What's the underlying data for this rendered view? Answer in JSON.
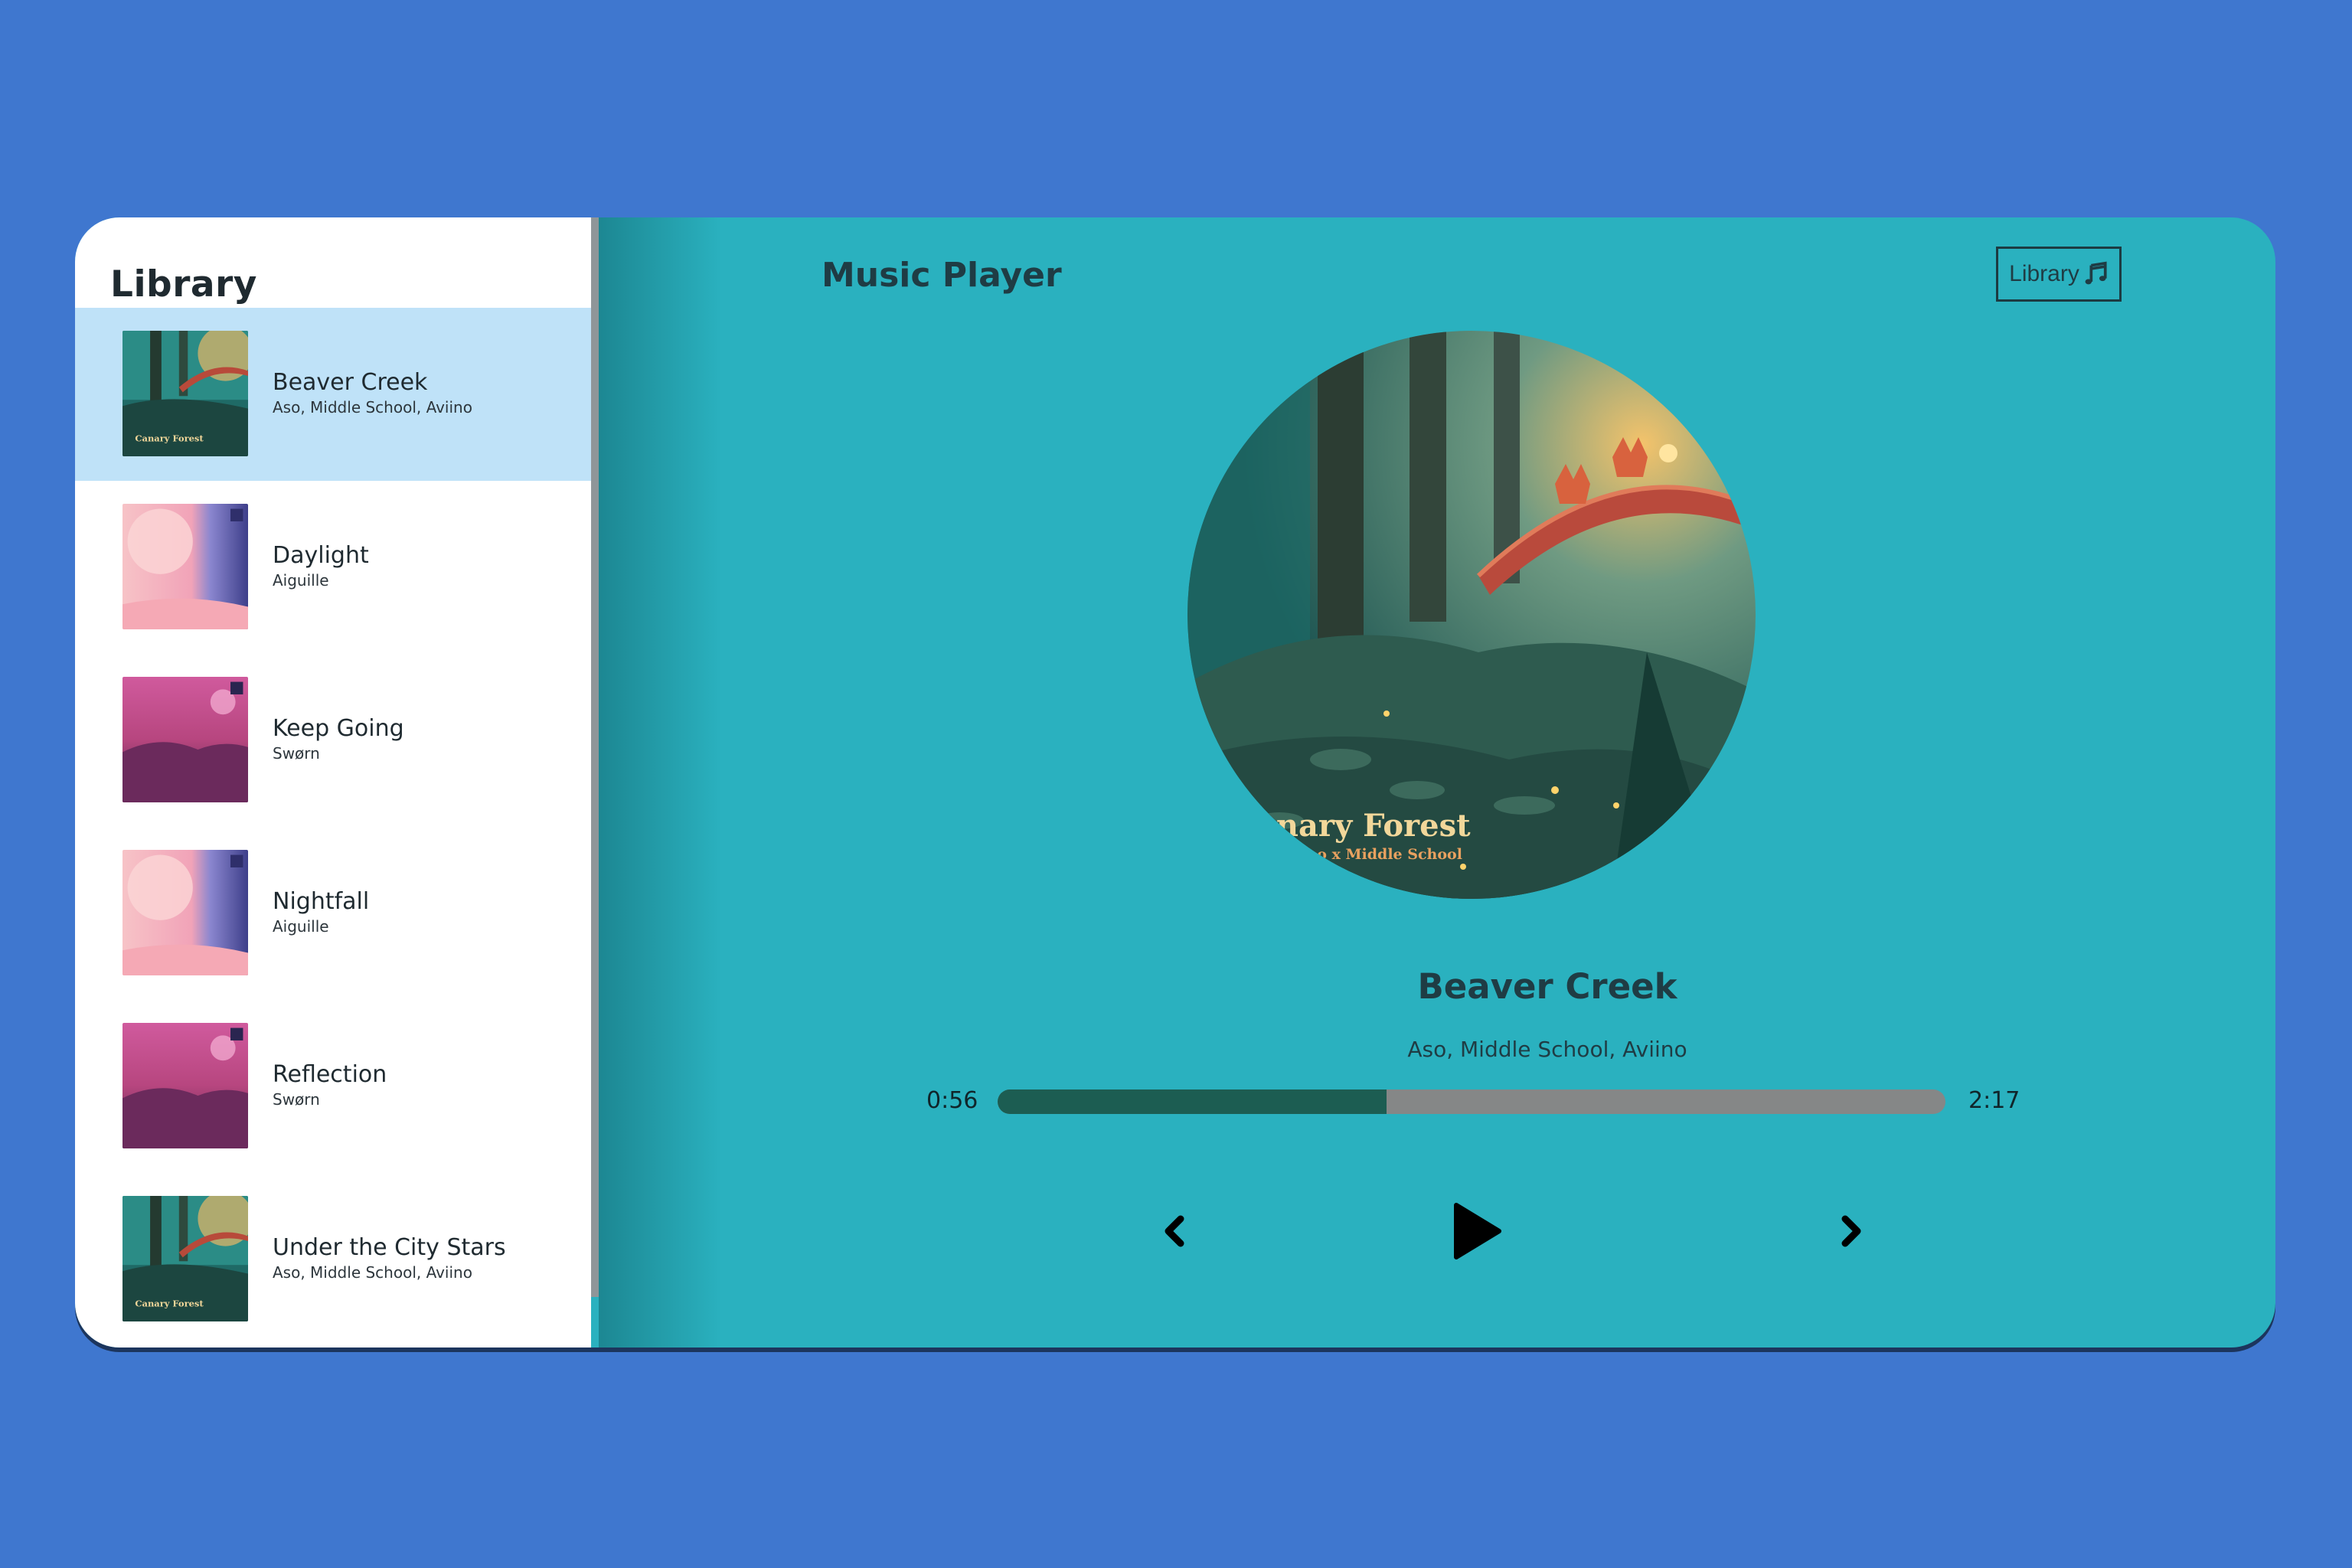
{
  "library": {
    "title": "Library",
    "songs": [
      {
        "name": "Beaver Creek",
        "artist": "Aso, Middle School, Aviino",
        "active": true,
        "art": "forest"
      },
      {
        "name": "Daylight",
        "artist": "Aiguille",
        "active": false,
        "art": "pastel"
      },
      {
        "name": "Keep Going",
        "artist": "Swørn",
        "active": false,
        "art": "magenta"
      },
      {
        "name": "Nightfall",
        "artist": "Aiguille",
        "active": false,
        "art": "pastel"
      },
      {
        "name": "Reflection",
        "artist": "Swørn",
        "active": false,
        "art": "magenta"
      },
      {
        "name": "Under the City Stars",
        "artist": "Aso, Middle School, Aviino",
        "active": false,
        "art": "forest"
      }
    ]
  },
  "player": {
    "title": "Music Player",
    "library_button_label": "Library",
    "library_button_icon": "music-note-icon",
    "now_playing": {
      "title": "Beaver Creek",
      "artist": "Aso, Middle School, Aviino",
      "cover_text": "anary Forest",
      "cover_subtext": "viino x Middle School"
    },
    "current_time": "0:56",
    "total_time": "2:17",
    "progress": 0.41,
    "controls": {
      "prev_icon": "chevron-left-icon",
      "play_icon": "play-icon",
      "next_icon": "chevron-right-icon"
    }
  },
  "colors": {
    "background": "#3f77cf",
    "player_bg": "#2ab1bf",
    "active_row": "#bfe2f8",
    "progress_fill": "#1c5d52",
    "progress_track": "#858787"
  }
}
